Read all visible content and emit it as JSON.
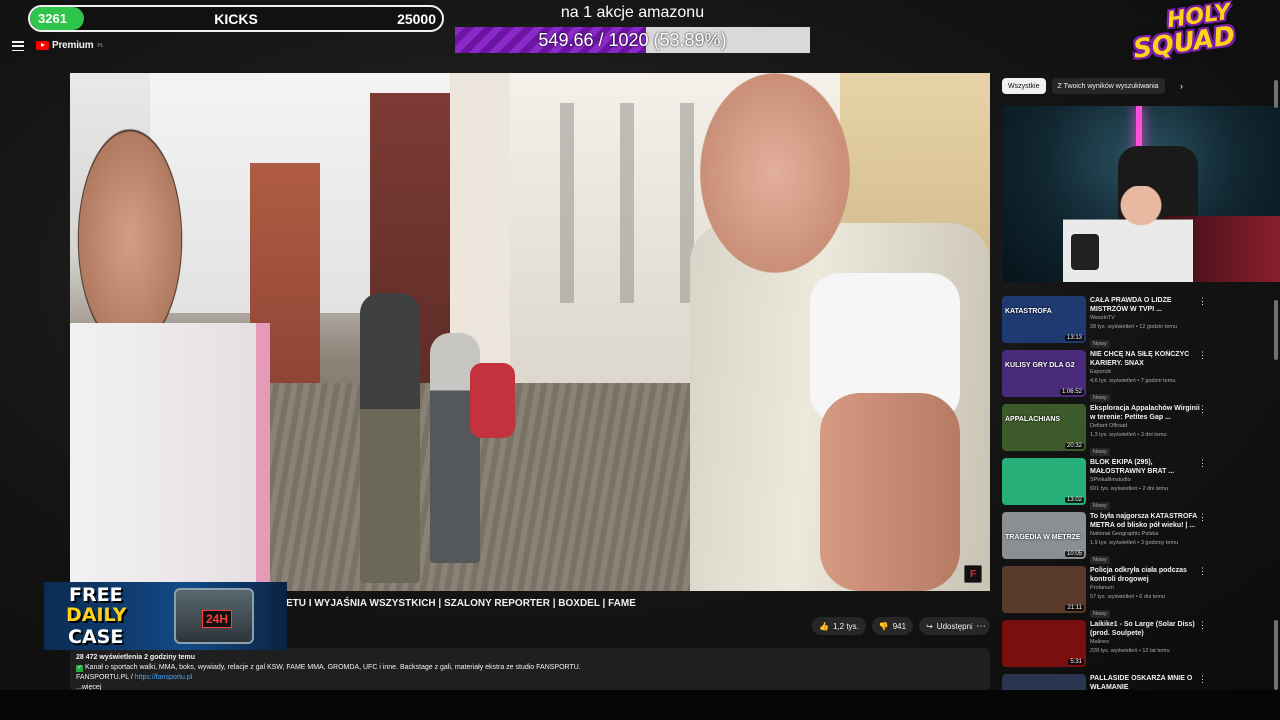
{
  "youtube": {
    "logo_text": "Premium",
    "logo_region": "PL",
    "video_title": "ETU I WYJAŚNIA WSZYSTKICH | SZALONY REPORTER | BOXDEL | FAME",
    "actions": {
      "likes": "1,2 tys.",
      "dislikes": "941",
      "share": "Udostępnij"
    },
    "description": {
      "views_line": "28 472 wyświetlenia  2 godziny temu",
      "line1": "Kanał o sportach walki, MMA, boks, wywiady, relacje z gal KSW, FAME MMA, GROMDA, UFC i inne. Backstage z gali, materiały ekstra ze studio FANSPORTU.",
      "line2_prefix": "FANSPORTU.PL / ",
      "line2_link": "https://fansportu.pl",
      "more": "...więcej"
    },
    "chips": [
      "Wszystkie",
      "Z Twoich wyników wyszukiwania"
    ],
    "recommendations": [
      {
        "title": "CAŁA PRAWDA O LIDZE MISTRZÓW W TVPI ...",
        "channel": "WeszloTV",
        "meta": "28 tys. wyświetleń • 12 godzin temu",
        "badge": "Nowy",
        "duration": "13:13",
        "thumb_text": "KATASTROFA",
        "thumb_color": "#1e3a70"
      },
      {
        "title": "NIE CHCĘ NA SIŁĘ KOŃCZYĆ KARIERY. SNAX",
        "channel": "Esporcik",
        "meta": "4,6 tys. wyświetleń • 7 godzin temu",
        "badge": "Nowy",
        "duration": "1:06:52",
        "thumb_text": "KULISY GRY DLA G2",
        "thumb_color": "#4a2a7a"
      },
      {
        "title": "Eksploracja Appalachów Wirginii w terenie: Petites Gap ...",
        "channel": "Defiant Offroad",
        "meta": "1,3 tys. wyświetleń • 3 dni temu",
        "badge": "Nowy",
        "duration": "20:32",
        "thumb_text": "APPALACHIANS",
        "thumb_color": "#3d5a2a"
      },
      {
        "title": "BLOK EKIPA (295), MAŁOSTRAWNY BRAT ...",
        "channel": "SPinkafilmstudio",
        "meta": "601 tys. wyświetleń • 2 dni temu",
        "badge": "Nowy",
        "duration": "13:02",
        "thumb_text": "",
        "thumb_color": "#27b07a"
      },
      {
        "title": "To była najgorsza KATASTROFA METRA od blisko pół wieku! | ...",
        "channel": "National Geographic Polska",
        "meta": "1,9 tys. wyświetleń • 3 godziny temu",
        "badge": "Nowy",
        "duration": "10:05",
        "thumb_text": "TRAGEDIA W METRZE",
        "thumb_color": "#8a8f94"
      },
      {
        "title": "Policja odkryła ciała podczas kontroli drogowej",
        "channel": "Profanum",
        "meta": "57 tys. wyświetleń • 6 dni temu",
        "badge": "Nowy",
        "duration": "21:11",
        "thumb_text": "",
        "thumb_color": "#5a3a2a"
      },
      {
        "title": "Laikike1 - So Large (Solar Diss) (prod. Soulpete)",
        "channel": "Malines",
        "meta": "228 tys. wyświetleń • 12 lat temu",
        "badge": "",
        "duration": "5:31",
        "thumb_text": "",
        "thumb_color": "#7a0f0f"
      },
      {
        "title": "PALLASIDE OSKARŻA MNIE O WŁAMANIE",
        "channel": "",
        "meta": "",
        "badge": "",
        "duration": "",
        "thumb_text": "",
        "thumb_color": "#2a3550"
      }
    ]
  },
  "overlays": {
    "kicks": {
      "current": "3261",
      "label": "KICKS",
      "goal": "25000",
      "progress": 0.1304
    },
    "amazon": {
      "title": "na 1 akcje amazonu",
      "progress_text": "549.66 / 1020 (53.89%)",
      "progress": 0.5389
    },
    "logo": {
      "line1": "HOLY",
      "line2": "SQUAD"
    },
    "promo": {
      "line1": "FREE",
      "line2": "DAILY",
      "line3": "CASE",
      "chest_tag": "24H"
    }
  },
  "video_badge": "F"
}
